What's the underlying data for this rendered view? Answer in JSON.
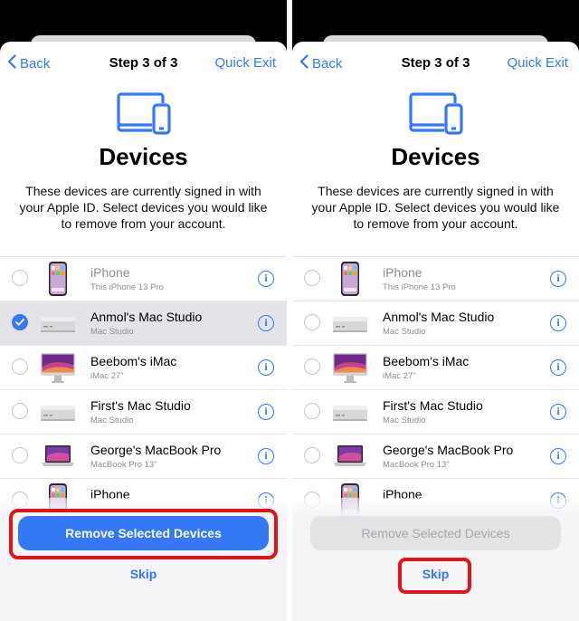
{
  "colors": {
    "accent": "#3478f6",
    "highlight": "#e0141c",
    "disabled_fill": "#e3e3e6"
  },
  "panels": [
    {
      "nav": {
        "back_label": "Back",
        "step_label": "Step 3 of 3",
        "quick_exit_label": "Quick Exit"
      },
      "title": "Devices",
      "description": "These devices are currently signed in with your Apple ID. Select devices you would like to remove from your account.",
      "devices": [
        {
          "name": "iPhone",
          "model": "This iPhone 13 Pro",
          "icon": "iphone-icon",
          "selected": false
        },
        {
          "name": "Anmol's Mac Studio",
          "model": "Mac Studio",
          "icon": "mac-studio-icon",
          "selected": true
        },
        {
          "name": "Beebom's iMac",
          "model": "iMac 27\"",
          "icon": "imac-icon",
          "selected": false
        },
        {
          "name": "First's Mac Studio",
          "model": "Mac Studio",
          "icon": "mac-studio-icon",
          "selected": false
        },
        {
          "name": "George's MacBook Pro",
          "model": "MacBook Pro 13\"",
          "icon": "macbook-icon",
          "selected": false
        },
        {
          "name": "iPhone",
          "model": "",
          "icon": "iphone-icon",
          "selected": false
        }
      ],
      "remove_label": "Remove Selected Devices",
      "remove_enabled": true,
      "skip_label": "Skip"
    },
    {
      "nav": {
        "back_label": "Back",
        "step_label": "Step 3 of 3",
        "quick_exit_label": "Quick Exit"
      },
      "title": "Devices",
      "description": "These devices are currently signed in with your Apple ID. Select devices you would like to remove from your account.",
      "devices": [
        {
          "name": "iPhone",
          "model": "This iPhone 13 Pro",
          "icon": "iphone-icon",
          "selected": false
        },
        {
          "name": "Anmol's Mac Studio",
          "model": "Mac Studio",
          "icon": "mac-studio-icon",
          "selected": false
        },
        {
          "name": "Beebom's iMac",
          "model": "iMac 27\"",
          "icon": "imac-icon",
          "selected": false
        },
        {
          "name": "First's Mac Studio",
          "model": "Mac Studio",
          "icon": "mac-studio-icon",
          "selected": false
        },
        {
          "name": "George's MacBook Pro",
          "model": "MacBook Pro 13\"",
          "icon": "macbook-icon",
          "selected": false
        },
        {
          "name": "iPhone",
          "model": "",
          "icon": "iphone-icon",
          "selected": false
        }
      ],
      "remove_label": "Remove Selected Devices",
      "remove_enabled": false,
      "skip_label": "Skip"
    }
  ]
}
